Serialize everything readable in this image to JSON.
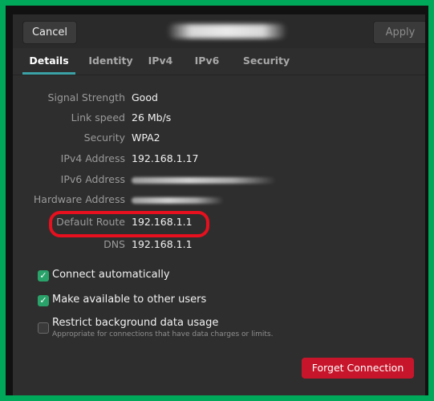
{
  "header": {
    "cancel_label": "Cancel",
    "apply_label": "Apply"
  },
  "tabs": [
    "Details",
    "Identity",
    "IPv4",
    "IPv6",
    "Security"
  ],
  "details": {
    "signal_strength": {
      "label": "Signal Strength",
      "value": "Good"
    },
    "link_speed": {
      "label": "Link speed",
      "value": "26 Mb/s"
    },
    "security": {
      "label": "Security",
      "value": "WPA2"
    },
    "ipv4_address": {
      "label": "IPv4 Address",
      "value": "192.168.1.17"
    },
    "ipv6_address": {
      "label": "IPv6 Address"
    },
    "hardware_address": {
      "label": "Hardware Address"
    },
    "default_route": {
      "label": "Default Route",
      "value": "192.168.1.1"
    },
    "dns": {
      "label": "DNS",
      "value": "192.168.1.1"
    }
  },
  "options": {
    "connect_automatically": {
      "label": "Connect automatically",
      "checked": true
    },
    "available_to_others": {
      "label": "Make available to other users",
      "checked": true
    },
    "restrict_background": {
      "label": "Restrict background data usage",
      "sublabel": "Appropriate for connections that have data charges or limits.",
      "checked": false
    }
  },
  "forget_label": "Forget Connection",
  "colors": {
    "accent": "#3ba2a8",
    "checkbox": "#2aa36a",
    "destructive": "#c7162b",
    "highlight": "#e6101e"
  }
}
